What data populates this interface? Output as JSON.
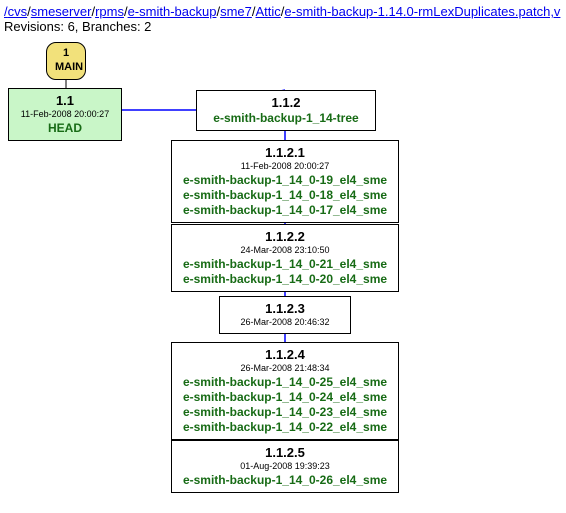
{
  "path_parts": [
    {
      "text": "/",
      "link": true
    },
    {
      "text": "cvs",
      "link": true
    },
    {
      "text": "/",
      "link": false
    },
    {
      "text": "smeserver",
      "link": true
    },
    {
      "text": "/",
      "link": false
    },
    {
      "text": "rpms",
      "link": true
    },
    {
      "text": "/",
      "link": false
    },
    {
      "text": "e-smith-backup",
      "link": true
    },
    {
      "text": "/",
      "link": false
    },
    {
      "text": "sme7",
      "link": true
    },
    {
      "text": "/",
      "link": false
    },
    {
      "text": "Attic",
      "link": true
    },
    {
      "text": "/",
      "link": false
    },
    {
      "text": "e-smith-backup-1.14.0-rmLexDuplicates.patch,v",
      "link": true
    }
  ],
  "stats": "Revisions: 6, Branches: 2",
  "main": {
    "label1": "1",
    "label2": "MAIN"
  },
  "head": {
    "rev": "1.1",
    "date": "11-Feb-2008 20:00:27",
    "tag": "HEAD"
  },
  "branch": {
    "rev": "1.1.2",
    "name": "e-smith-backup-1_14-tree"
  },
  "n1": {
    "rev": "1.1.2.1",
    "date": "11-Feb-2008 20:00:27",
    "tags": [
      "e-smith-backup-1_14_0-19_el4_sme",
      "e-smith-backup-1_14_0-18_el4_sme",
      "e-smith-backup-1_14_0-17_el4_sme"
    ]
  },
  "n2": {
    "rev": "1.1.2.2",
    "date": "24-Mar-2008 23:10:50",
    "tags": [
      "e-smith-backup-1_14_0-21_el4_sme",
      "e-smith-backup-1_14_0-20_el4_sme"
    ]
  },
  "n3": {
    "rev": "1.1.2.3",
    "date": "26-Mar-2008 20:46:32",
    "tags": []
  },
  "n4": {
    "rev": "1.1.2.4",
    "date": "26-Mar-2008 21:48:34",
    "tags": [
      "e-smith-backup-1_14_0-25_el4_sme",
      "e-smith-backup-1_14_0-24_el4_sme",
      "e-smith-backup-1_14_0-23_el4_sme",
      "e-smith-backup-1_14_0-22_el4_sme"
    ]
  },
  "n5": {
    "rev": "1.1.2.5",
    "date": "01-Aug-2008 19:39:23",
    "tags": [
      "e-smith-backup-1_14_0-26_el4_sme"
    ]
  }
}
